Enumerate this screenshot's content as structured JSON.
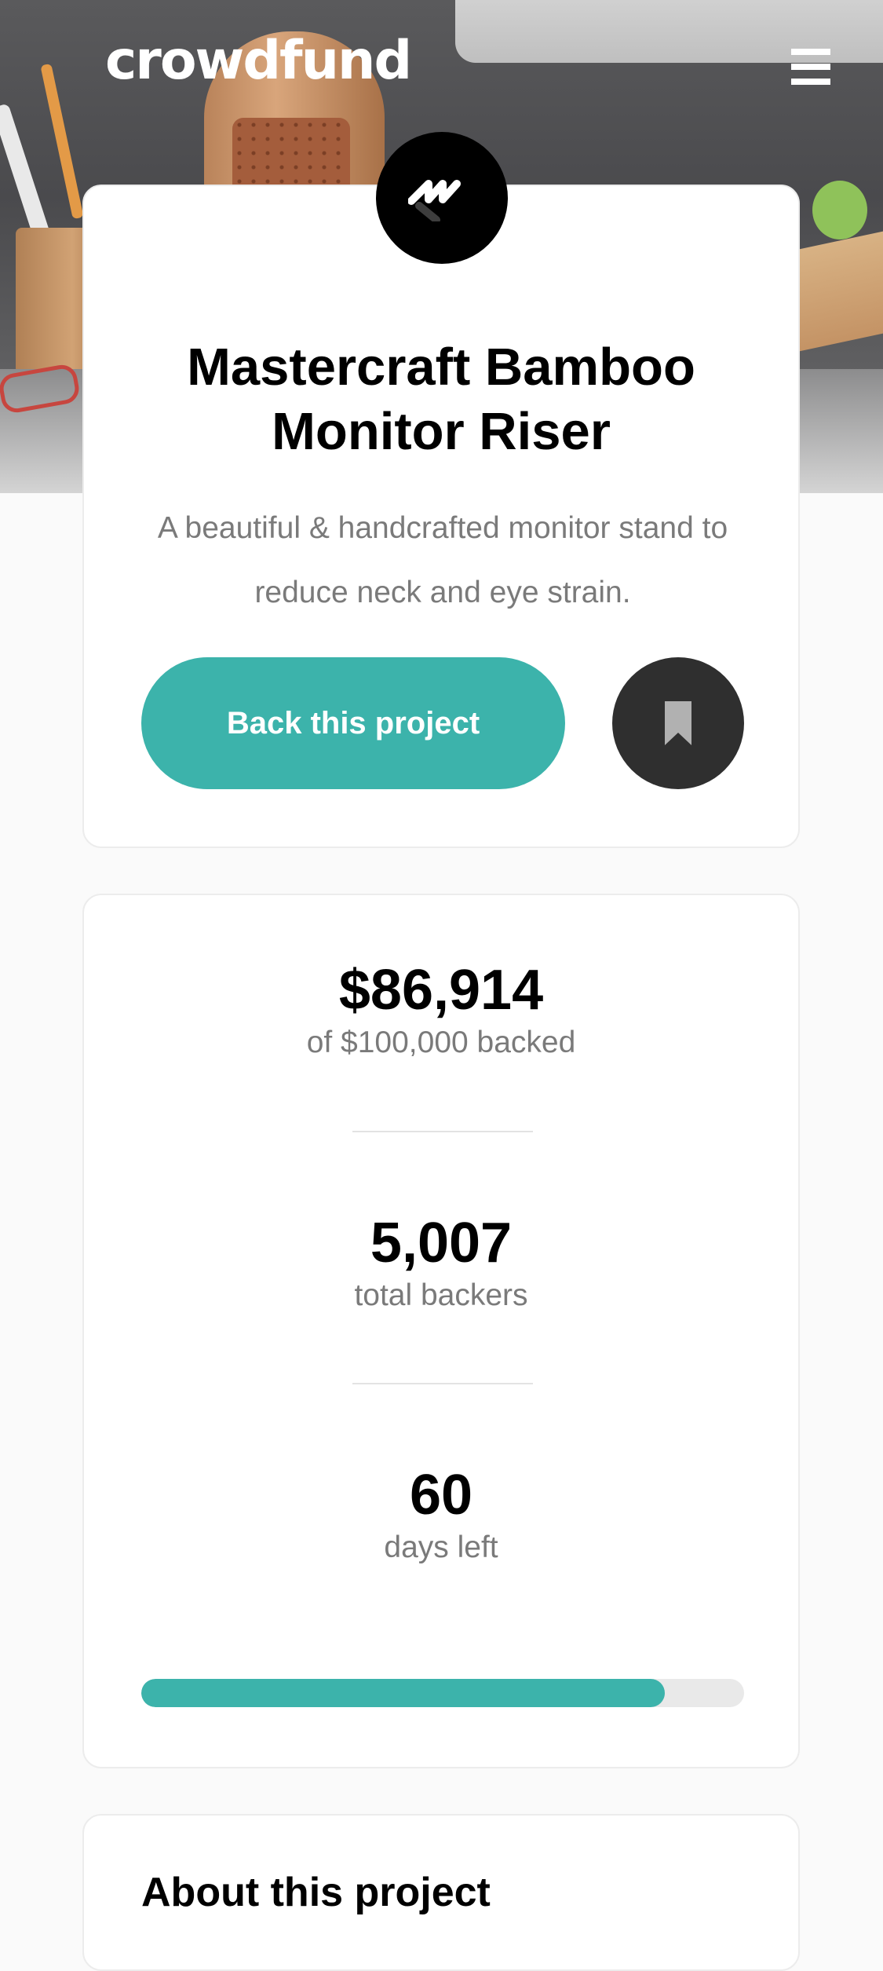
{
  "header": {
    "logo_text": "crowdfund",
    "menu_icon": "hamburger-icon"
  },
  "project": {
    "badge_icon": "mastercraft-logo-icon",
    "title": "Mastercraft Bamboo Monitor Riser",
    "description": "A beautiful & handcrafted monitor stand to reduce neck and eye strain.",
    "back_button_label": "Back this project",
    "bookmark_icon": "bookmark-icon"
  },
  "stats": {
    "backed_amount": "$86,914",
    "backed_label": "of $100,000 backed",
    "backers_count": "5,007",
    "backers_label": "total backers",
    "days_left": "60",
    "days_label": "days left",
    "progress_fraction": 0.869
  },
  "about": {
    "heading": "About this project"
  },
  "colors": {
    "accent": "#3cb3ab",
    "dark": "#2f2f2f",
    "text_muted": "#7a7a7a",
    "background": "#fafafa"
  }
}
